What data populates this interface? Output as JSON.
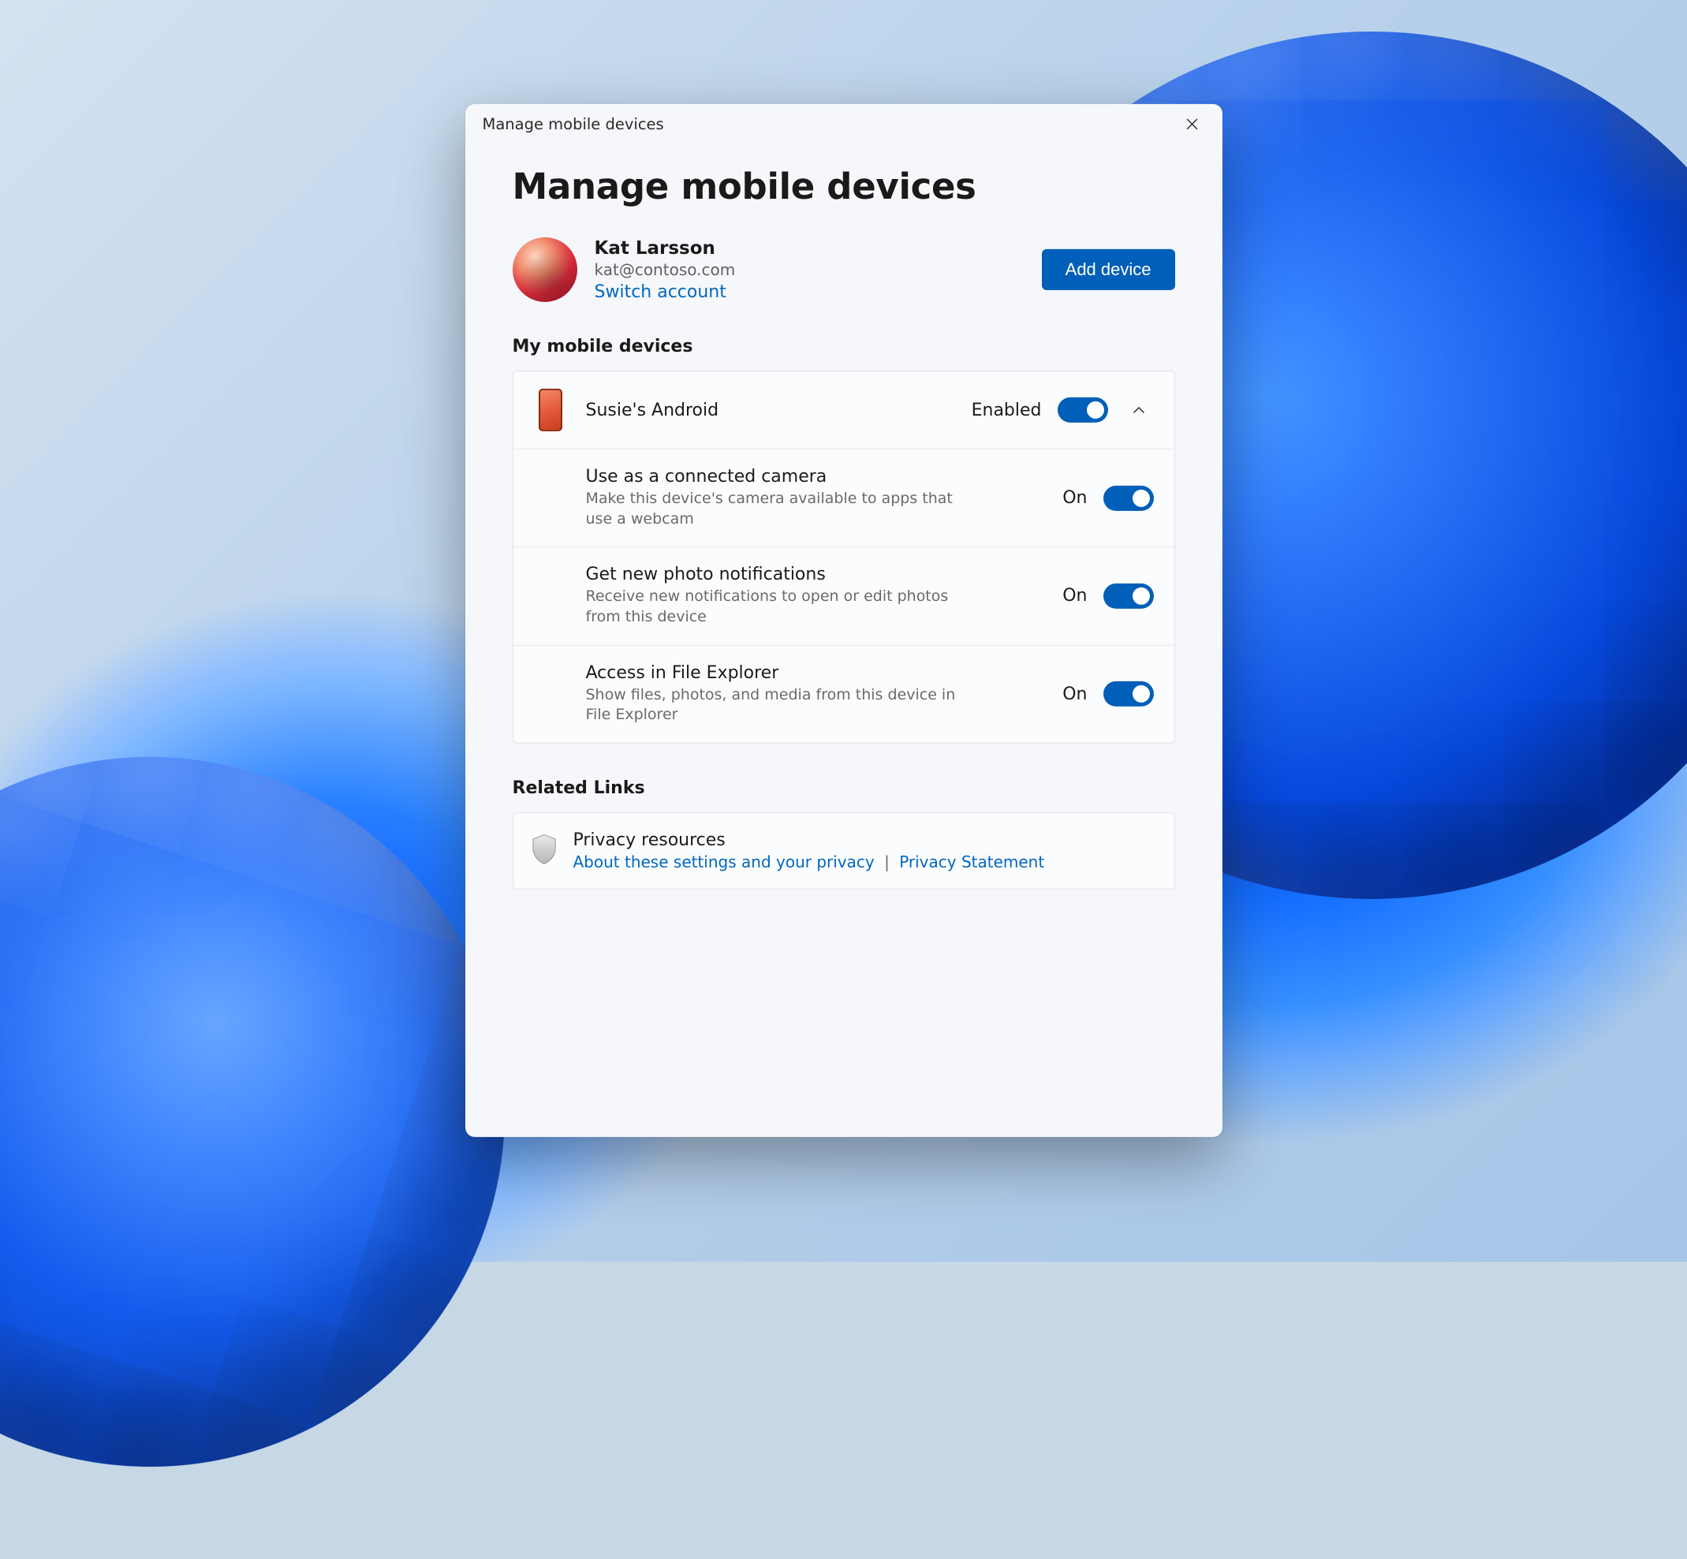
{
  "window": {
    "title": "Manage mobile devices"
  },
  "page": {
    "heading": "Manage mobile devices"
  },
  "account": {
    "name": "Kat Larsson",
    "email": "kat@contoso.com",
    "switch_label": "Switch account",
    "add_device_label": "Add device"
  },
  "devices_section": {
    "heading": "My mobile devices",
    "device": {
      "name": "Susie's Android",
      "status_label": "Enabled",
      "enabled": true
    },
    "settings": [
      {
        "title": "Use as a connected camera",
        "description": "Make this device's camera available to apps that use a webcam",
        "status_label": "On",
        "on": true
      },
      {
        "title": "Get new photo notifications",
        "description": "Receive new notifications to open or edit photos from this device",
        "status_label": "On",
        "on": true
      },
      {
        "title": "Access in File Explorer",
        "description": "Show files, photos, and media from this device in File Explorer",
        "status_label": "On",
        "on": true
      }
    ]
  },
  "related": {
    "heading": "Related Links",
    "privacy_title": "Privacy resources",
    "link_about": "About these settings and your privacy",
    "link_statement": "Privacy Statement",
    "separator": "|"
  },
  "colors": {
    "accent": "#005fb8",
    "link": "#0067c0"
  }
}
